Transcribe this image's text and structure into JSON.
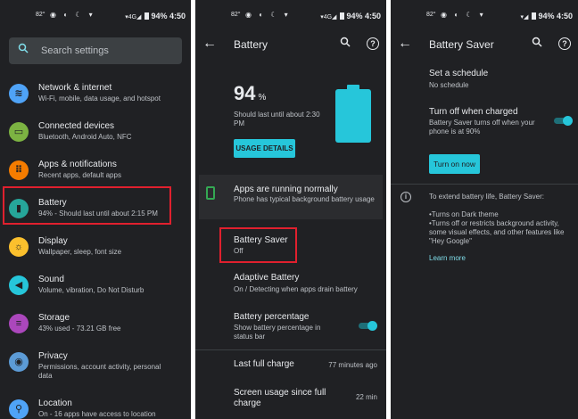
{
  "status_bar": [
    {
      "time": "4:50",
      "left": "82°",
      "battery": "94%"
    },
    {
      "time": "4:50",
      "left": "82°",
      "battery": "94%"
    },
    {
      "time": "4:50",
      "left": "82°",
      "battery": "94%"
    }
  ],
  "settings": {
    "search_placeholder": "Search settings",
    "items": [
      {
        "title": "Network & internet",
        "subtitle": "Wi-Fi, mobile, data usage, and hotspot",
        "icon": "wifi-icon",
        "color": "#4fa3f7"
      },
      {
        "title": "Connected devices",
        "subtitle": "Bluetooth, Android Auto, NFC",
        "icon": "devices-icon",
        "color": "#7cb342"
      },
      {
        "title": "Apps & notifications",
        "subtitle": "Recent apps, default apps",
        "icon": "apps-icon",
        "color": "#f57c00"
      },
      {
        "title": "Battery",
        "subtitle": "94% - Should last until about 2:15 PM",
        "icon": "battery-icon",
        "color": "#26a69a"
      },
      {
        "title": "Display",
        "subtitle": "Wallpaper, sleep, font size",
        "icon": "brightness-icon",
        "color": "#fbc02d"
      },
      {
        "title": "Sound",
        "subtitle": "Volume, vibration, Do Not Disturb",
        "icon": "volume-icon",
        "color": "#26c6da"
      },
      {
        "title": "Storage",
        "subtitle": "43% used - 73.21 GB free",
        "icon": "storage-icon",
        "color": "#ab47bc"
      },
      {
        "title": "Privacy",
        "subtitle": "Permissions, account activity, personal data",
        "icon": "eye-icon",
        "color": "#5c9bd6"
      },
      {
        "title": "Location",
        "subtitle": "On - 16 apps have access to location",
        "icon": "location-icon",
        "color": "#4fa3f7"
      }
    ]
  },
  "battery": {
    "title": "Battery",
    "percent": "94",
    "percent_unit": "%",
    "last_until": "Should last until about 2:30 PM",
    "usage_details_label": "USAGE DETAILS",
    "status_card": {
      "title": "Apps are running normally",
      "subtitle": "Phone has typical background battery usage"
    },
    "battery_saver": {
      "title": "Battery Saver",
      "subtitle": "Off"
    },
    "adaptive": {
      "title": "Adaptive Battery",
      "subtitle": "On / Detecting when apps drain battery"
    },
    "percentage": {
      "title": "Battery percentage",
      "subtitle": "Show battery percentage in status bar",
      "enabled": true
    },
    "last_full_charge": {
      "title": "Last full charge",
      "value": "77 minutes ago"
    },
    "screen_usage": {
      "title": "Screen usage since full charge",
      "value": "22 min"
    }
  },
  "saver": {
    "title": "Battery Saver",
    "schedule": {
      "title": "Set a schedule",
      "subtitle": "No schedule"
    },
    "turn_off": {
      "title": "Turn off when charged",
      "subtitle": "Battery Saver turns off when your phone is at 90%",
      "enabled": true
    },
    "turn_on_label": "Turn on now",
    "info_intro": "To extend battery life, Battery Saver:",
    "info_bullets": "•Turns on Dark theme\n•Turns off or restricts background activity, some visual effects, and other features like \"Hey Google\"",
    "learn_more": "Learn more"
  },
  "colors": {
    "accent": "#26c6da",
    "background": "#202124",
    "highlight": "#e0202e"
  }
}
